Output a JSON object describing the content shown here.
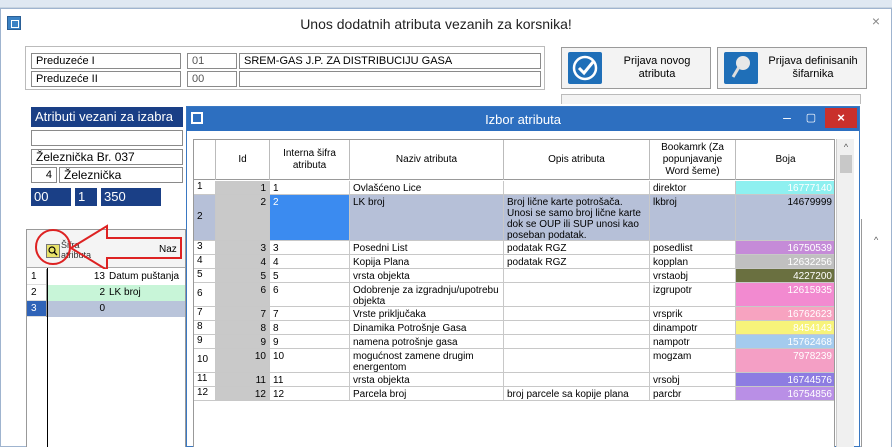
{
  "window": {
    "title": "Unos dodatnih atributa vezanih za korsnika!",
    "close": "×"
  },
  "company": {
    "label1": "Preduzeće I",
    "label2": "Preduzeće II",
    "code1": "01",
    "name1": "SREM-GAS J.P. ZA DISTRIBUCIJU GASA",
    "code2": "00",
    "name2": ""
  },
  "buttons": {
    "new_attr": "Prijava novog atributa",
    "defined_codebook": "Prijava definisanih šifarnika"
  },
  "section": {
    "header": "Atributi vezani za izabra",
    "street": "Železnička Br. 037",
    "num": "4",
    "street2": "Železnička",
    "f1": "00",
    "f2": "1",
    "f3": "350"
  },
  "left_grid": {
    "col_sifra": "Šifra atributa",
    "col_naz": "Naz",
    "rows": [
      {
        "idx": "1",
        "val": "13",
        "name": "Datum puštanja",
        "color": "#ffffff"
      },
      {
        "idx": "2",
        "val": "2",
        "name": "LK broj",
        "color": "#c8f5d8"
      },
      {
        "idx": "3",
        "val": "0",
        "name": "",
        "color": "#b9c4da"
      }
    ]
  },
  "popup": {
    "title": "Izbor atributa",
    "min": "–",
    "max": "▢",
    "close": "×",
    "headers": {
      "id": "Id",
      "internal": "Interna šifra atributa",
      "name": "Naziv atributa",
      "desc": "Opis atributa",
      "bookmark": "Bookamrk (Za popunjavanje Word šeme)",
      "color": "Boja"
    },
    "rows": [
      {
        "n": "1",
        "id": "1",
        "code": "1",
        "name": "Ovlašćeno Lice",
        "desc": "",
        "bm": "direktor",
        "color": "16777140",
        "bg": "#8ef0f0",
        "tc": "#ffffff"
      },
      {
        "n": "2",
        "id": "2",
        "code": "2",
        "name": "LK broj",
        "desc": "Broj lične karte potrošača. Unosi se samo broj lične karte dok se OUP ili SUP unosi kao poseban podatak.",
        "bm": "lkbroj",
        "color": "14679999",
        "bg": "#b6c0d8",
        "tc": "#000000"
      },
      {
        "n": "3",
        "id": "3",
        "code": "3",
        "name": "Posedni List",
        "desc": "podatak RGZ",
        "bm": "posedlist",
        "color": "16750539",
        "bg": "#c58bd8",
        "tc": "#ffffff"
      },
      {
        "n": "4",
        "id": "4",
        "code": "4",
        "name": "Kopija Plana",
        "desc": "podatak RGZ",
        "bm": "kopplan",
        "color": "12632256",
        "bg": "#c0c0c0",
        "tc": "#ffffff"
      },
      {
        "n": "5",
        "id": "5",
        "code": "5",
        "name": "vrsta objekta",
        "desc": "",
        "bm": "vrstaobj",
        "color": "4227200",
        "bg": "#6a7040",
        "tc": "#ffffff"
      },
      {
        "n": "6",
        "id": "6",
        "code": "6",
        "name": "Odobrenje za izgradnju/upotrebu objekta",
        "desc": "",
        "bm": "izgrupotr",
        "color": "12615935",
        "bg": "#f28ad0",
        "tc": "#ffffff"
      },
      {
        "n": "7",
        "id": "7",
        "code": "7",
        "name": "Vrste priključaka",
        "desc": "",
        "bm": "vrsprik",
        "color": "16762623",
        "bg": "#f7a3c0",
        "tc": "#ffffff"
      },
      {
        "n": "8",
        "id": "8",
        "code": "8",
        "name": "Dinamika Potrošnje Gasa",
        "desc": "",
        "bm": "dinampotr",
        "color": "8454143",
        "bg": "#f7f37a",
        "tc": "#ffffff"
      },
      {
        "n": "9",
        "id": "9",
        "code": "9",
        "name": "namena potrošnje gasa",
        "desc": "",
        "bm": "nampotr",
        "color": "15762468",
        "bg": "#a4cbee",
        "tc": "#ffffff"
      },
      {
        "n": "10",
        "id": "10",
        "code": "10",
        "name": "mogućnost zamene drugim energentom",
        "desc": "",
        "bm": "mogzam",
        "color": "7978239",
        "bg": "#f49fc5",
        "tc": "#ffffff"
      },
      {
        "n": "11",
        "id": "11",
        "code": "11",
        "name": "vrsta objekta",
        "desc": "",
        "bm": "vrsobj",
        "color": "16744576",
        "bg": "#8d7ce2",
        "tc": "#ffffff"
      },
      {
        "n": "12",
        "id": "12",
        "code": "12",
        "name": "Parcela broj",
        "desc": "broj parcele sa kopije plana RGZ",
        "bm": "parcbr",
        "color": "16754856",
        "bg": "#b98fe6",
        "tc": "#ffffff"
      }
    ]
  },
  "icons": {
    "app": "app-icon",
    "check": "checkmark-icon",
    "pin": "pushpin-icon",
    "search": "search-icon",
    "arrow": "annotation-arrow-icon"
  }
}
